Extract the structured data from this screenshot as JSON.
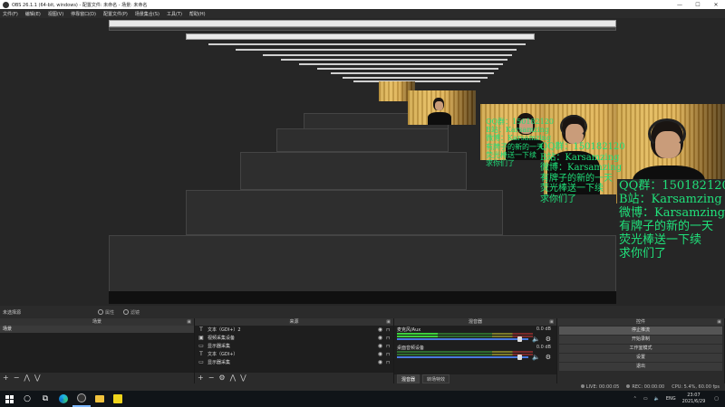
{
  "window": {
    "title": "OBS 26.1.1 (64-bit, windows) - 配置文件: 未命名 - 场景: 未命名",
    "min": "—",
    "max": "☐",
    "close": "✕"
  },
  "menu": [
    "文件(F)",
    "编辑(E)",
    "视图(V)",
    "停靠窗口(D)",
    "配置文件(P)",
    "场景集合(S)",
    "工具(T)",
    "帮助(H)"
  ],
  "overlay": {
    "qq": "QQ群：150182120",
    "bili": "B站：Karsamzing",
    "weibo": "微博：Karsamzing",
    "line1": "有牌子的新的一天",
    "line2": "荧光棒送一下续",
    "line3": "求你们了"
  },
  "scene_status": {
    "label": "未选择源",
    "properties": "属性",
    "filters": "滤镜"
  },
  "scenes": {
    "header": "场景",
    "items": [
      "场景"
    ]
  },
  "sources": {
    "header": "来源",
    "items": [
      {
        "icon": "T",
        "label": "文本（GDI+）2"
      },
      {
        "icon": "▣",
        "label": "视频采集设备"
      },
      {
        "icon": "▭",
        "label": "显示器采集"
      },
      {
        "icon": "T",
        "label": "文本（GDI+）"
      },
      {
        "icon": "▭",
        "label": "显示器采集"
      }
    ]
  },
  "mixer": {
    "header": "混音器",
    "channels": [
      {
        "name": "麦克风/Aux",
        "db": "0.0 dB",
        "thumb": 0.95
      },
      {
        "name": "桌面音频设备",
        "db": "0.0 dB",
        "thumb": 0.95
      }
    ],
    "tabs": [
      "混音器",
      "转场特效"
    ]
  },
  "controls": {
    "header": "控件",
    "buttons": [
      "停止推流",
      "开始录制",
      "工作室模式",
      "设置",
      "退出"
    ]
  },
  "status": {
    "live": "LIVE: 00:00:05",
    "rec": "REC: 00:00:00",
    "cpu": "CPU: 5.4%, 60.00 fps"
  },
  "taskbar": {
    "lang": "ENG",
    "time": "23:07",
    "date": "2021/6/29"
  },
  "icons": {
    "eye": "eye-icon",
    "lock": "lock-icon",
    "gear": "gear-icon",
    "speaker": "speaker-icon"
  },
  "colors": {
    "overlay_text": "#20e07a",
    "accent_blue": "#4a7adf",
    "meter_green": "#3cd03c"
  }
}
